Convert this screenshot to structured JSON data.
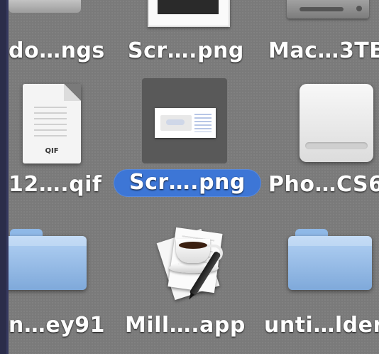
{
  "finder": {
    "rows": [
      {
        "items": [
          {
            "label": "do…ngs",
            "icon": "document-icon"
          },
          {
            "label": "Scr….png",
            "icon": "screenshot-image-icon"
          },
          {
            "label": "Mac…3TB",
            "icon": "hard-drive-icon"
          }
        ]
      },
      {
        "items": [
          {
            "label": "12….qif",
            "icon": "qif-document-icon",
            "ext": "QIF"
          },
          {
            "label": "Scr….png",
            "icon": "screenshot-image-icon",
            "selected": true
          },
          {
            "label": "Pho…CS6",
            "icon": "external-drive-icon"
          }
        ]
      },
      {
        "items": [
          {
            "label": "n…ey91",
            "icon": "folder-icon"
          },
          {
            "label": "Mill….app",
            "icon": "application-icon"
          },
          {
            "label": "unti…lder",
            "icon": "folder-icon"
          }
        ]
      }
    ]
  },
  "colors": {
    "background": "#7a7a7a",
    "selection": "#3d76d6",
    "dark_edge": "#2a2b46"
  }
}
